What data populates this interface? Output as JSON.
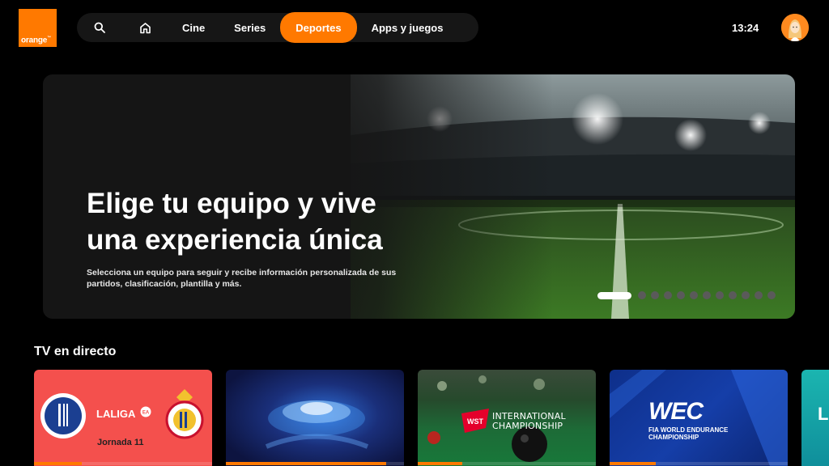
{
  "brand": {
    "logo_text": "orange",
    "accent": "#ff7900"
  },
  "nav": {
    "search_icon": "search-icon",
    "home_icon": "home-icon",
    "items": [
      {
        "label": "Cine"
      },
      {
        "label": "Series"
      },
      {
        "label": "Deportes",
        "active": true
      },
      {
        "label": "Apps y juegos"
      }
    ]
  },
  "clock": "13:24",
  "hero": {
    "title_line1": "Elige tu equipo y vive",
    "title_line2": "una experiencia única",
    "subtitle": "Selecciona un equipo para seguir y recibe información personalizada de sus partidos, clasificación, plantilla y más.",
    "carousel": {
      "total": 12,
      "active_index": 0
    }
  },
  "live_tv": {
    "title": "TV en directo",
    "cards": [
      {
        "league": "LALIGA",
        "label": "Jornada 11",
        "progress": 0.27
      },
      {
        "progress": 0.9
      },
      {
        "title_line1": "INTERNATIONAL",
        "title_line2": "CHAMPIONSHIP",
        "badge": "WST",
        "progress": 0.25
      },
      {
        "logo": "WEC",
        "subtitle_line1": "FIA WORLD ENDURANCE",
        "subtitle_line2": "CHAMPIONSHIP",
        "progress": 0.26
      },
      {
        "letter": "L"
      }
    ]
  }
}
